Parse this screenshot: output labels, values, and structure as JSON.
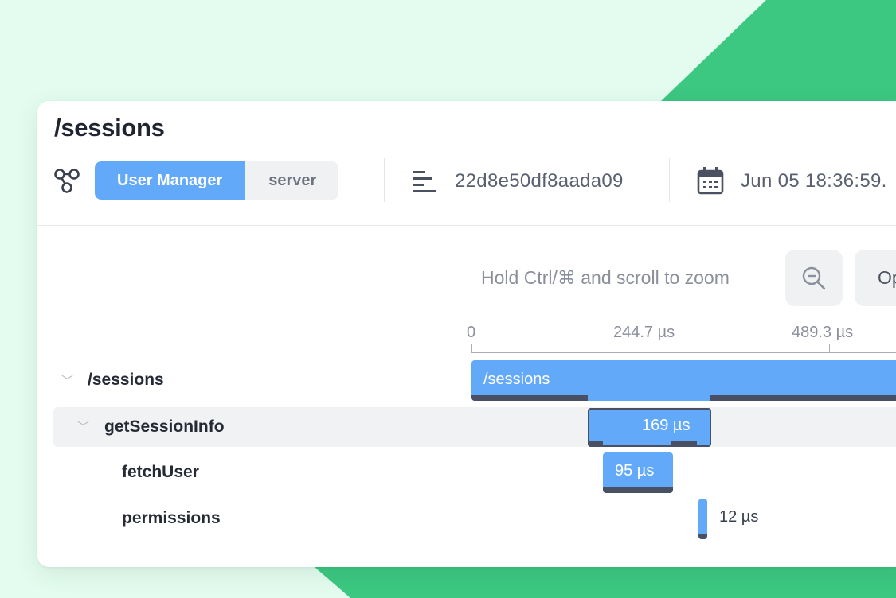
{
  "colors": {
    "background": "#e3fcef",
    "accent_green": "#3cc881",
    "bar_blue": "#63a9fa",
    "bar_underline": "#4a5064",
    "card": "#ffffff"
  },
  "page": {
    "title": "/sessions"
  },
  "meta": {
    "service_icon": "service-graph-icon",
    "service_name": "User Manager",
    "service_kind": "server",
    "trace_icon": "trace-lines-icon",
    "trace_id": "22d8e50df8aada09",
    "date_icon": "calendar-icon",
    "timestamp": "Jun 05 18:36:59."
  },
  "toolbar": {
    "zoom_hint": "Hold Ctrl/⌘ and scroll to zoom",
    "zoom_out_icon": "zoom-out-icon",
    "open_label": "Op"
  },
  "timeline": {
    "unit": "µs",
    "ticks": [
      "0",
      "244.7 µs",
      "489.3 µs"
    ],
    "spans": [
      {
        "name": "/sessions",
        "label": "/sessions",
        "depth": 0,
        "expanded": true
      },
      {
        "name": "getSessionInfo",
        "label": "169 µs",
        "depth": 1,
        "expanded": true,
        "duration_us": 169
      },
      {
        "name": "fetchUser",
        "label": "95 µs",
        "depth": 2,
        "duration_us": 95
      },
      {
        "name": "permissions",
        "label": "12 µs",
        "depth": 2,
        "duration_us": 12
      }
    ]
  }
}
